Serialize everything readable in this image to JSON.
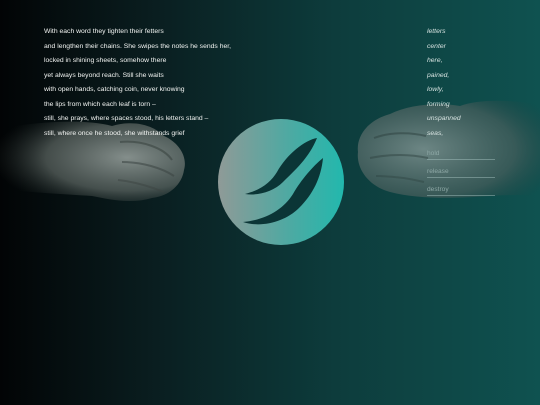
{
  "poem": {
    "lines": [
      "With each word they tighten their fetters",
      "and lengthen their chains. She swipes the notes he sends her,",
      "locked in shining sheets, somehow there",
      "yet always beyond reach. Still she waits",
      "with open hands, catching coin, never knowing",
      "the lips from which each leaf is torn –",
      "still, she prays, where spaces stood, his letters stand –",
      "still, where once he stood, she withstands grief"
    ]
  },
  "words": [
    "letters",
    "center",
    "here,",
    "pained,",
    "lowly,",
    "forming",
    "unspanned",
    "seas,"
  ],
  "actions": {
    "hold": "hold",
    "release": "release",
    "destroy": "destroy"
  },
  "colors": {
    "accent": "#2fb8ae",
    "background_left": "#020405",
    "background_right": "#0f5250"
  },
  "icons": {
    "logo": "teal-leaf-logo-icon",
    "left_hand": "left-fist-icon",
    "right_hand": "right-fist-icon"
  }
}
